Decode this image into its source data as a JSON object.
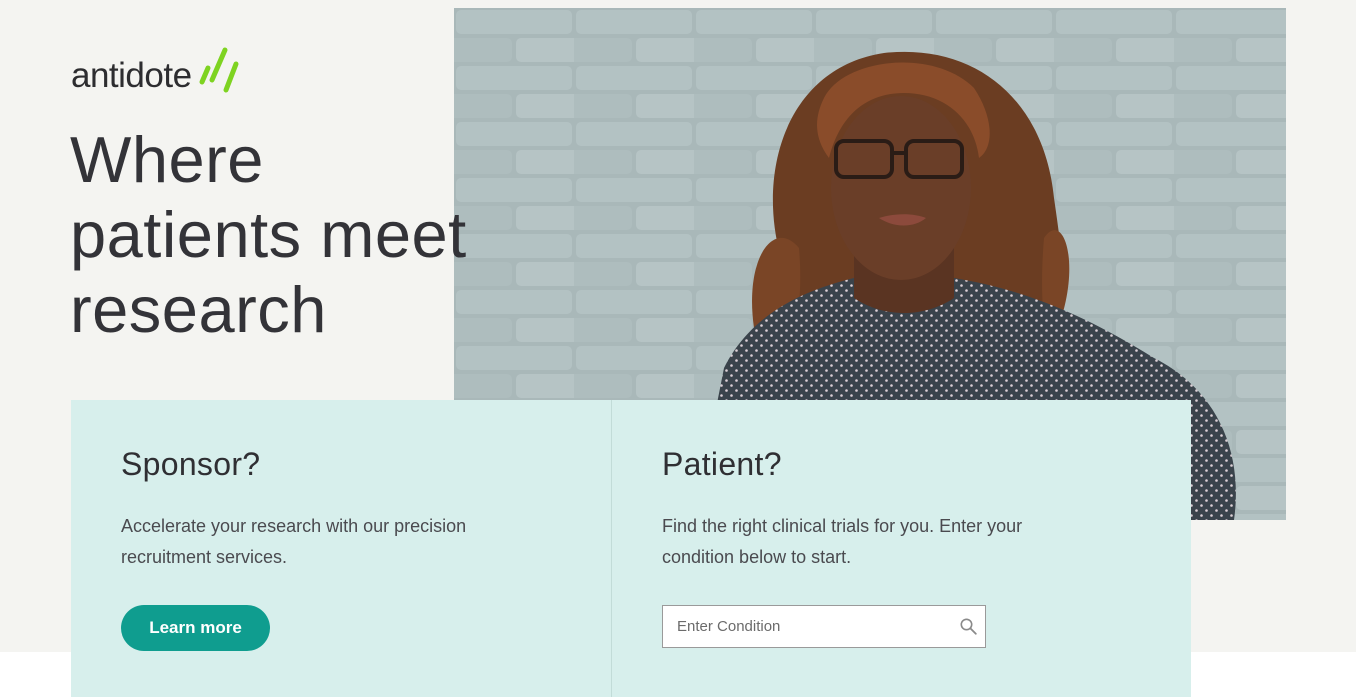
{
  "brand": {
    "name": "antidote",
    "mark_color": "#7ed321"
  },
  "hero": {
    "title_lines": [
      "Where",
      "patients meet",
      "research"
    ]
  },
  "sponsor": {
    "title": "Sponsor?",
    "text": "Accelerate your research with our precision recruitment services.",
    "button_label": "Learn more"
  },
  "patient": {
    "title": "Patient?",
    "text": "Find the right clinical trials for you. Enter your condition below to start.",
    "search_placeholder": "Enter Condition"
  },
  "colors": {
    "background": "#f4f4f1",
    "card_background": "#d7efec",
    "button": "#0f9d8f",
    "text": "#2f2f33"
  },
  "icons": {
    "search": "search-icon",
    "logo_mark": "logo-slashes-icon"
  }
}
